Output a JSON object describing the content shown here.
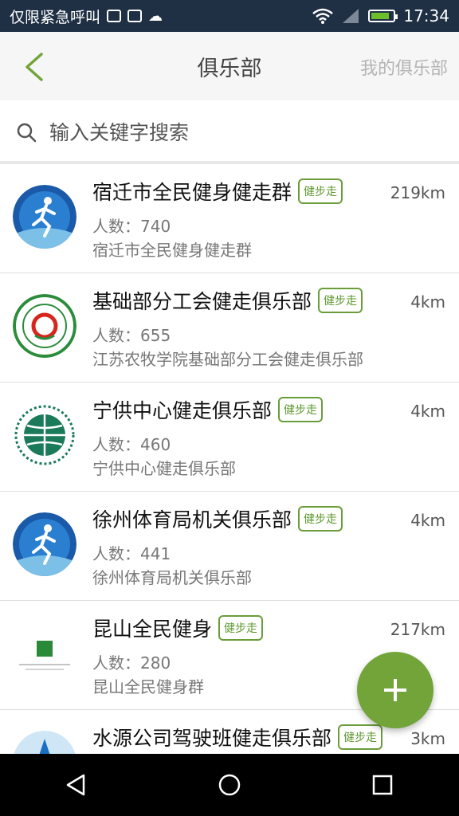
{
  "status_bar": {
    "carrier_text": "仅限紧急呼叫",
    "time": "17:34"
  },
  "app_bar": {
    "title": "俱乐部",
    "my_clubs_label": "我的俱乐部"
  },
  "search": {
    "placeholder": "输入关键字搜索",
    "value": ""
  },
  "tag_label": "健步走",
  "clubs": [
    {
      "name": "宿迁市全民健身健走群",
      "distance": "219km",
      "members": "人数：740",
      "desc": "宿迁市全民健身健走群",
      "avatar": "runner-logo-icon"
    },
    {
      "name": "基础部分工会健走俱乐部",
      "distance": "4km",
      "members": "人数：655",
      "desc": "江苏农牧学院基础部分工会健走俱乐部",
      "avatar": "union-emblem-icon"
    },
    {
      "name": "宁供中心健走俱乐部",
      "distance": "4km",
      "members": "人数：460",
      "desc": "宁供中心健走俱乐部",
      "avatar": "state-grid-logo-icon"
    },
    {
      "name": "徐州体育局机关俱乐部",
      "distance": "4km",
      "members": "人数：441",
      "desc": "徐州体育局机关俱乐部",
      "avatar": "runner-logo-icon"
    },
    {
      "name": "昆山全民健身",
      "distance": "217km",
      "members": "人数：280",
      "desc": "昆山全民健身群",
      "avatar": "small-logo-icon"
    },
    {
      "name": "水源公司驾驶班健走俱乐部",
      "distance": "3km",
      "members": "",
      "desc": "",
      "avatar": "water-logo-icon"
    }
  ],
  "colors": {
    "accent": "#72a43a",
    "status_bar": "#1f2f44",
    "tag_border": "#6a9d3a"
  }
}
